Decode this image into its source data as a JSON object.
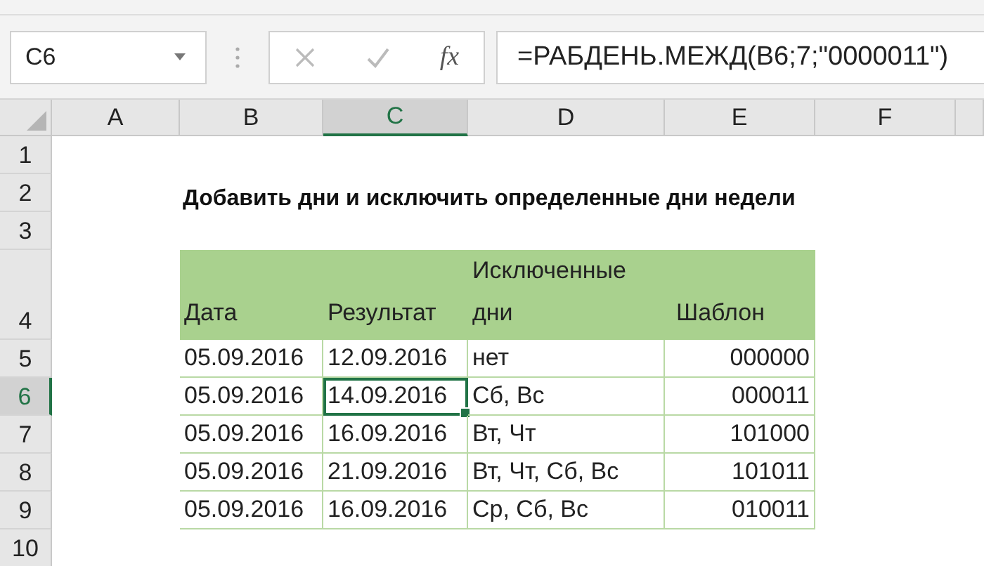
{
  "name_box": "C6",
  "formula_bar": {
    "cancel_disabled": true,
    "enter_disabled": true,
    "function_button": "fx",
    "formula": "=РАБДЕНЬ.МЕЖД(B6;7;\"0000011\")"
  },
  "columns": [
    {
      "label": "A",
      "selected": false
    },
    {
      "label": "B",
      "selected": false
    },
    {
      "label": "C",
      "selected": true
    },
    {
      "label": "D",
      "selected": false
    },
    {
      "label": "E",
      "selected": false
    },
    {
      "label": "F",
      "selected": false
    }
  ],
  "rows": [
    {
      "label": "1",
      "selected": false
    },
    {
      "label": "2",
      "selected": false
    },
    {
      "label": "3",
      "selected": false
    },
    {
      "label": "4",
      "selected": false
    },
    {
      "label": "5",
      "selected": false
    },
    {
      "label": "6",
      "selected": true
    },
    {
      "label": "7",
      "selected": false
    },
    {
      "label": "8",
      "selected": false
    },
    {
      "label": "9",
      "selected": false
    },
    {
      "label": "10",
      "selected": false
    }
  ],
  "title": "Добавить дни и исключить определенные дни недели",
  "table": {
    "headers": [
      "Дата",
      "Результат",
      "Исключенные дни",
      "Шаблон"
    ],
    "rows": [
      {
        "cells": [
          {
            "text": "05.09.2016",
            "selected": false
          },
          {
            "text": "12.09.2016",
            "selected": false
          },
          {
            "text": "нет",
            "selected": false
          },
          {
            "text": "000000",
            "selected": false
          }
        ]
      },
      {
        "cells": [
          {
            "text": "05.09.2016",
            "selected": false
          },
          {
            "text": "14.09.2016",
            "selected": true
          },
          {
            "text": "Сб, Вс",
            "selected": false
          },
          {
            "text": "000011",
            "selected": false
          }
        ]
      },
      {
        "cells": [
          {
            "text": "05.09.2016",
            "selected": false
          },
          {
            "text": "16.09.2016",
            "selected": false
          },
          {
            "text": "Вт, Чт",
            "selected": false
          },
          {
            "text": "101000",
            "selected": false
          }
        ]
      },
      {
        "cells": [
          {
            "text": "05.09.2016",
            "selected": false
          },
          {
            "text": "21.09.2016",
            "selected": false
          },
          {
            "text": "Вт, Чт, Сб, Вс",
            "selected": false
          },
          {
            "text": "101011",
            "selected": false
          }
        ]
      },
      {
        "cells": [
          {
            "text": "05.09.2016",
            "selected": false
          },
          {
            "text": "16.09.2016",
            "selected": false
          },
          {
            "text": "Ср, Сб, Вс",
            "selected": false
          },
          {
            "text": "010011",
            "selected": false
          }
        ]
      }
    ]
  }
}
